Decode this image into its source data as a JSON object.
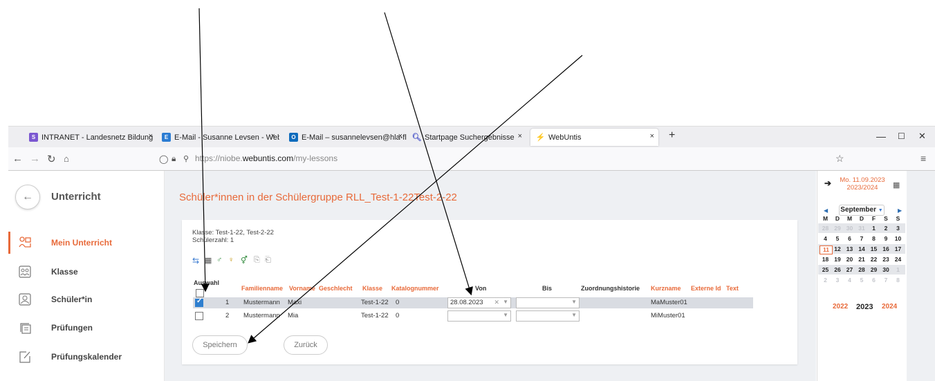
{
  "browser": {
    "tabs": [
      {
        "label": "INTRANET - Landesnetz Bildung",
        "close": "×",
        "fav_color": "#7b57d1",
        "fav": "S"
      },
      {
        "label": "E-Mail - Susanne Levsen - Webr",
        "close": "×",
        "fav_color": "#2b7cd3",
        "fav": "E"
      },
      {
        "label": "E-Mail – susannelevsen@hla-fle",
        "close": "×",
        "fav_color": "#0f6cbd",
        "fav": "O"
      },
      {
        "label": "Startpage Suchergebnisse",
        "close": "×",
        "fav_color": "#ffffff",
        "fav": "Q"
      },
      {
        "label": "WebUntis",
        "close": "×",
        "fav_color": "#ffffff",
        "fav": "⚡"
      }
    ],
    "new_tab": "+",
    "url_prefix": "https://niobe.",
    "url_host": "webuntis.com",
    "url_path": "/my-lessons",
    "window_controls": [
      "—",
      "☐",
      "✕"
    ]
  },
  "sidebar": {
    "title": "Unterricht",
    "items": [
      {
        "label": "Mein Unterricht",
        "active": true
      },
      {
        "label": "Klasse",
        "active": false
      },
      {
        "label": "Schüler*in",
        "active": false
      },
      {
        "label": "Prüfungen",
        "active": false
      },
      {
        "label": "Prüfungskalender",
        "active": false
      }
    ]
  },
  "main": {
    "title": "Schüler*innen in der Schülergruppe RLL_Test-1-22Test-2-22",
    "klasse": "Klasse: Test-1-22, Test-2-22",
    "schuelerzahl": "Schülerzahl: 1",
    "columns": {
      "auswahl": "Auswahl",
      "familienname": "Familienname",
      "vorname": "Vorname",
      "geschlecht": "Geschlecht",
      "klasse": "Klasse",
      "katalognummer": "Katalognummer",
      "von": "Von",
      "bis": "Bis",
      "zuordnungshistorie": "Zuordnungshistorie",
      "kurzname": "Kurzname",
      "externe_id": "Externe Id",
      "text": "Text"
    },
    "rows": [
      {
        "nr": "1",
        "familienname": "Mustermann",
        "vorname": "Maxi",
        "klasse": "Test-1-22",
        "katalognummer": "0",
        "von": "28.08.2023",
        "bis": "",
        "kurzname": "MaMuster01",
        "selected": true
      },
      {
        "nr": "2",
        "familienname": "Mustermann",
        "vorname": "Mia",
        "klasse": "Test-1-22",
        "katalognummer": "0",
        "von": "",
        "bis": "",
        "kurzname": "MiMuster01",
        "selected": false
      }
    ],
    "save_button": "Speichern",
    "back_button": "Zurück"
  },
  "calendar": {
    "date_line1": "Mo. 11.09.2023",
    "date_line2": "2023/2024",
    "month": "September",
    "weekdays": [
      "M",
      "D",
      "M",
      "D",
      "F",
      "S",
      "S"
    ],
    "weeks": [
      [
        "28",
        "29",
        "30",
        "31",
        "1",
        "2",
        "3"
      ],
      [
        "4",
        "5",
        "6",
        "7",
        "8",
        "9",
        "10"
      ],
      [
        "11",
        "12",
        "13",
        "14",
        "15",
        "16",
        "17"
      ],
      [
        "18",
        "19",
        "20",
        "21",
        "22",
        "23",
        "24"
      ],
      [
        "25",
        "26",
        "27",
        "28",
        "29",
        "30",
        "1"
      ],
      [
        "2",
        "3",
        "4",
        "5",
        "6",
        "7",
        "8"
      ]
    ],
    "years": [
      "2022",
      "2023",
      "2024"
    ],
    "accent": "#e86a3a"
  }
}
